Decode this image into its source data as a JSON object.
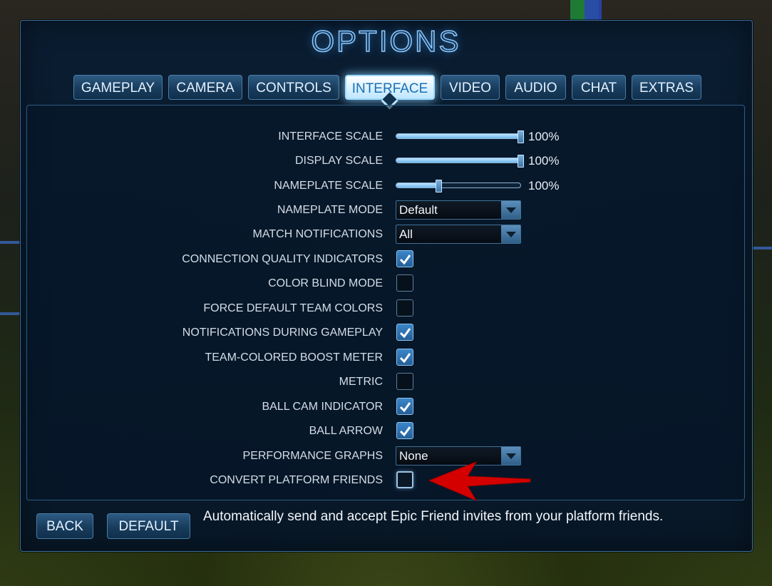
{
  "title": "OPTIONS",
  "tabs": [
    {
      "label": "GAMEPLAY",
      "active": false
    },
    {
      "label": "CAMERA",
      "active": false
    },
    {
      "label": "CONTROLS",
      "active": false
    },
    {
      "label": "INTERFACE",
      "active": true
    },
    {
      "label": "VIDEO",
      "active": false
    },
    {
      "label": "AUDIO",
      "active": false
    },
    {
      "label": "CHAT",
      "active": false
    },
    {
      "label": "EXTRAS",
      "active": false
    }
  ],
  "settings": {
    "interface_scale": {
      "label": "INTERFACE SCALE",
      "value": "100%",
      "level": 1.0
    },
    "display_scale": {
      "label": "DISPLAY SCALE",
      "value": "100%",
      "level": 1.0
    },
    "nameplate_scale": {
      "label": "NAMEPLATE SCALE",
      "value": "100%",
      "level": 0.33
    },
    "nameplate_mode": {
      "label": "NAMEPLATE MODE",
      "value": "Default"
    },
    "match_notifications": {
      "label": "MATCH NOTIFICATIONS",
      "value": "All"
    },
    "connection_quality_indicators": {
      "label": "CONNECTION QUALITY INDICATORS",
      "checked": true
    },
    "color_blind_mode": {
      "label": "COLOR BLIND MODE",
      "checked": false
    },
    "force_default_team_colors": {
      "label": "FORCE DEFAULT TEAM COLORS",
      "checked": false
    },
    "notifications_during_gameplay": {
      "label": "NOTIFICATIONS DURING GAMEPLAY",
      "checked": true
    },
    "team_colored_boost_meter": {
      "label": "TEAM-COLORED BOOST METER",
      "checked": true
    },
    "metric": {
      "label": "METRIC",
      "checked": false
    },
    "ball_cam_indicator": {
      "label": "BALL CAM INDICATOR",
      "checked": true
    },
    "ball_arrow": {
      "label": "BALL ARROW",
      "checked": true
    },
    "performance_graphs": {
      "label": "PERFORMANCE GRAPHS",
      "value": "None"
    },
    "convert_platform_friends": {
      "label": "CONVERT PLATFORM FRIENDS",
      "checked": false
    }
  },
  "footer": {
    "back_label": "BACK",
    "default_label": "DEFAULT",
    "hint": "Automatically send and accept Epic Friend invites from your platform friends."
  },
  "colors": {
    "accent": "#8cc8ff",
    "checkbox_checked": "#2f73b3",
    "annotation_arrow": "#d40000"
  },
  "icons": {
    "check": "check-icon",
    "dropdown": "chevron-down-icon",
    "annotation": "red-arrow-icon"
  }
}
